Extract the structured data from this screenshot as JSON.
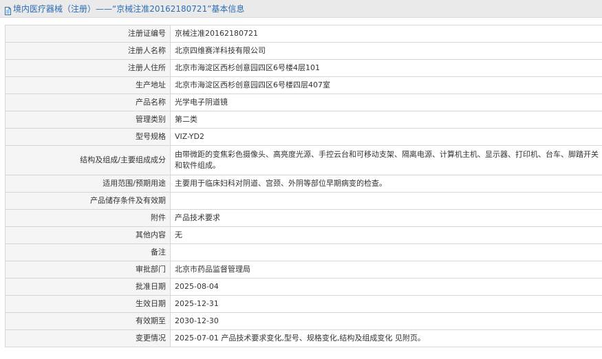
{
  "header": {
    "title": "境内医疗器械（注册）——“京械注准20162180721”基本信息",
    "icon": "document-icon",
    "accent_color": "#2b6cb5"
  },
  "rows": [
    {
      "label": "注册证编号",
      "value": "京械注准20162180721"
    },
    {
      "label": "注册人名称",
      "value": "北京四维赛洋科技有限公司"
    },
    {
      "label": "注册人住所",
      "value": "北京市海淀区西杉创意园四区6号楼4层101"
    },
    {
      "label": "生产地址",
      "value": "北京市海淀区西杉创意园四区6号楼四层407室"
    },
    {
      "label": "产品名称",
      "value": "光学电子阴道镜"
    },
    {
      "label": "管理类别",
      "value": "第二类"
    },
    {
      "label": "型号规格",
      "value": "VIZ-YD2"
    },
    {
      "label": "结构及组成/主要组成成分",
      "value": "由带微距的变焦彩色摄像头、高亮度光源、手控云台和可移动支架、隔离电源、计算机主机、显示器、打印机、台车、脚踏开关和软件组成。"
    },
    {
      "label": "适用范围/预期用途",
      "value": "主要用于临床妇科对阴道、宫颈、外阴等部位早期病变的检查。"
    },
    {
      "label": "产品储存条件及有效期",
      "value": ""
    },
    {
      "label": "附件",
      "value": "产品技术要求"
    },
    {
      "label": "其他内容",
      "value": "无"
    },
    {
      "label": "备注",
      "value": ""
    },
    {
      "label": "审批部门",
      "value": "北京市药品监督管理局"
    },
    {
      "label": "批准日期",
      "value": "2025-08-04"
    },
    {
      "label": "生效日期",
      "value": "2025-12-31"
    },
    {
      "label": "有效期至",
      "value": "2030-12-30"
    },
    {
      "label": "变更情况",
      "value": "2025-07-01 产品技术要求变化,型号、规格变化,结构及组成变化 见附页。"
    }
  ]
}
